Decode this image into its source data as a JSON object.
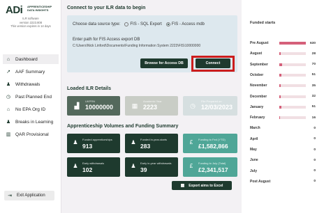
{
  "app": {
    "logo_text": "ADi",
    "logo_subtitle_1": "APPRENTICESHIP",
    "logo_subtitle_2": "DATA INSIGHTS",
    "software_line": "ILR software",
    "version_line": "version 2223.808",
    "expiry_line": "This version expires in 14 days"
  },
  "sidebar": {
    "items": [
      {
        "label": "Dashboard",
        "icon": "home-icon",
        "glyph": "⌂",
        "active": true
      },
      {
        "label": "AAF Summary",
        "icon": "trend-icon",
        "glyph": "↗",
        "active": false
      },
      {
        "label": "Withdrawals",
        "icon": "user-minus-icon",
        "glyph": "♟",
        "active": false
      },
      {
        "label": "Past Planned End",
        "icon": "clock-icon",
        "glyph": "◷",
        "active": false
      },
      {
        "label": "No EPA Org ID",
        "icon": "home-alert-icon",
        "glyph": "⌂",
        "active": false
      },
      {
        "label": "Breaks in Learning",
        "icon": "user-pause-icon",
        "glyph": "♟",
        "active": false
      },
      {
        "label": "QAR Provisional",
        "icon": "chart-icon",
        "glyph": "▥",
        "active": false
      }
    ],
    "exit_label": "Exit Application"
  },
  "connect": {
    "title": "Connect to your ILR data to begin",
    "source_label": "Choose data source type:",
    "option_sql": "FIS - SQL Export",
    "option_access": "FIS - Access mdb",
    "selected": "access",
    "path_label": "Enter path for FIS Access export DB",
    "path_value": "C:\\Users\\Nick Linford\\Documents\\Funding Information System 2223\\FIS\\10000000",
    "browse_label": "Browse for Access DB",
    "connect_label": "Connect"
  },
  "loaded": {
    "title": "Loaded ILR Details",
    "ukprn_label": "UKPRN",
    "ukprn_value": "10000000",
    "year_label": "Academic Year",
    "year_value": "2223",
    "prepared_label": "File Prepared on",
    "prepared_value": "12/03/2023"
  },
  "volumes": {
    "title": "Apprenticeship Volumes and Funding Summary",
    "funded_label": "Funded apprenticeships",
    "funded_value": "913",
    "funded_year_label": "Funded in-year-starts",
    "funded_year_value": "283",
    "funding_ytd_label": "Funding to Fed (YTD)",
    "funding_ytd_value": "£1,582,866",
    "early_withdrawals_label": "Early withdrawals",
    "early_withdrawals_value": "102",
    "early_inyear_label": "Early in-year withdrawals",
    "early_inyear_value": "39",
    "funding_total_label": "Funding to July (Total)",
    "funding_total_value": "£2,341,517",
    "export_label": "Export aims to Excel"
  },
  "funded_starts": {
    "title": "Funded starts",
    "max": 630,
    "rows": [
      {
        "month": "Pre August",
        "value": 630
      },
      {
        "month": "August",
        "value": 28
      },
      {
        "month": "September",
        "value": 70
      },
      {
        "month": "October",
        "value": 51
      },
      {
        "month": "November",
        "value": 35
      },
      {
        "month": "December",
        "value": 32
      },
      {
        "month": "January",
        "value": 51
      },
      {
        "month": "February",
        "value": 16
      },
      {
        "month": "March",
        "value": 0
      },
      {
        "month": "April",
        "value": 0
      },
      {
        "month": "May",
        "value": 0
      },
      {
        "month": "June",
        "value": 0
      },
      {
        "month": "July",
        "value": 0
      },
      {
        "month": "Post August",
        "value": 0
      }
    ]
  }
}
